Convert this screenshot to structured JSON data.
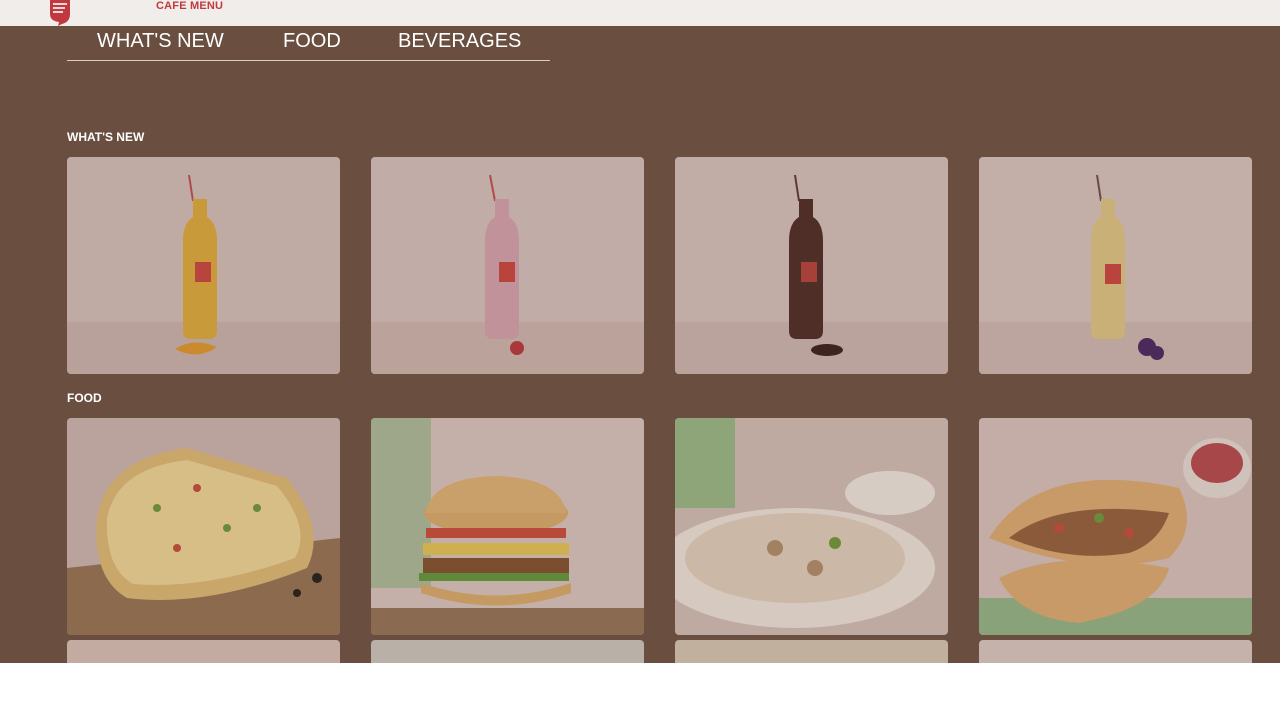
{
  "header": {
    "brand_title": "CAFE MENU",
    "logo_icon": "cafe-coffee-day-logo"
  },
  "tabs": [
    {
      "label": "WHAT'S NEW"
    },
    {
      "label": "FOOD"
    },
    {
      "label": "BEVERAGES"
    }
  ],
  "sections": {
    "whats_new": {
      "heading": "WHAT'S NEW",
      "items": [
        {
          "icon": "mango-shake-bottle"
        },
        {
          "icon": "strawberry-shake-bottle"
        },
        {
          "icon": "chocolate-shake-bottle"
        },
        {
          "icon": "vanilla-shake-bottle"
        }
      ]
    },
    "food": {
      "heading": "FOOD",
      "items": [
        {
          "icon": "garlic-bread-image"
        },
        {
          "icon": "veg-burger-image"
        },
        {
          "icon": "biryani-rice-image"
        },
        {
          "icon": "wrap-sandwich-image"
        }
      ]
    }
  },
  "colors": {
    "overlay": "#6a4f40",
    "topbar": "#f1edea",
    "brand_red": "#c0393e"
  }
}
